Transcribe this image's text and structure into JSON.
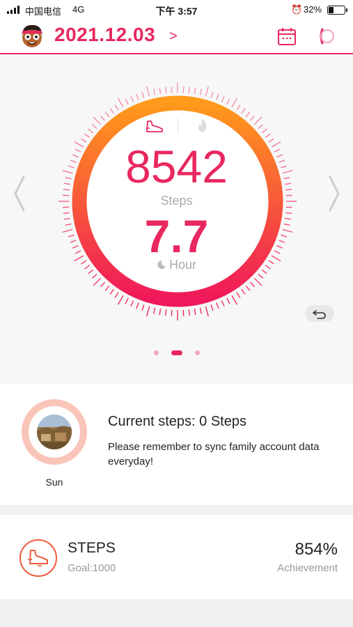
{
  "status_bar": {
    "carrier": "中国电信",
    "network": "4G",
    "time": "下午 3:57",
    "battery_percent": "32%",
    "battery_level": 0.32,
    "alarm_icon": "alarm-clock-icon"
  },
  "header": {
    "date": "2021.12.03",
    "next_arrow": ">",
    "calendar_icon": "calendar-icon",
    "device_icon": "watch-icon"
  },
  "ring": {
    "steps_value": "8542",
    "steps_label": "Steps",
    "hour_value": "7.7",
    "hour_label": "Hour",
    "mode_icons": [
      "shoe-icon",
      "flame-icon"
    ],
    "page_dots": 3,
    "active_dot": 1,
    "colors": {
      "accent": "#e8285f",
      "ring_start": "#ff9a1a",
      "ring_end": "#f0185a"
    }
  },
  "daily": {
    "day_label": "Sun",
    "current_steps": "Current steps: 0 Steps",
    "message": "Please remember to sync family account data everyday!"
  },
  "summary": {
    "title": "STEPS",
    "goal": "Goal:1000",
    "achievement_value": "854%",
    "achievement_label": "Achievement"
  }
}
